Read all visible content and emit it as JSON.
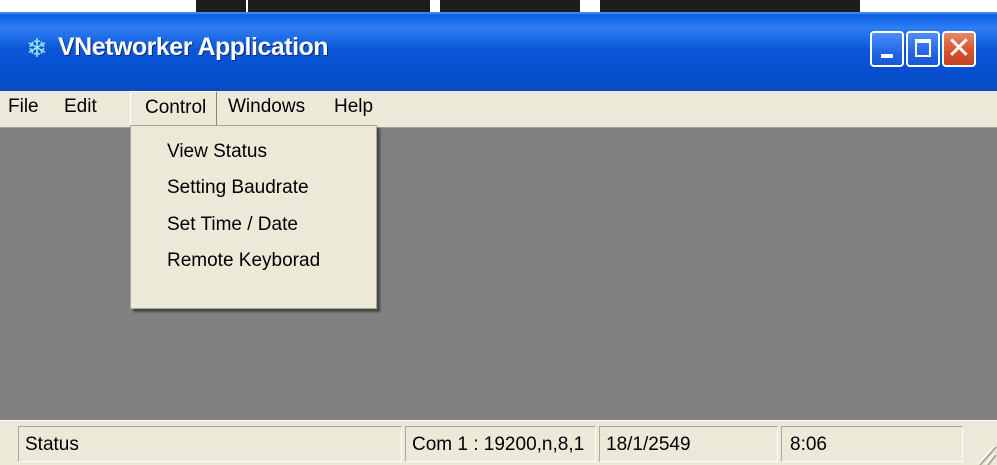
{
  "window": {
    "title": "VNetworker Application",
    "app_icon": "snowflake-icon",
    "controls": {
      "minimize_icon": "minimize-icon",
      "maximize_icon": "maximize-icon",
      "close_icon": "close-icon",
      "close_glyph": "✕"
    }
  },
  "menu": {
    "file": "File",
    "edit": "Edit",
    "control": "Control",
    "windows": "Windows",
    "help": "Help"
  },
  "control_menu": {
    "items": [
      "View Status",
      "Setting Baudrate",
      "Set Time / Date",
      "Remote Keyborad"
    ]
  },
  "statusbar": {
    "status": "Status",
    "com": "Com 1 : 19200,n,8,1",
    "date": "18/1/2549",
    "time": "8:06"
  },
  "colors": {
    "titlebar": "#0b58d8",
    "client_area": "#808080",
    "chrome": "#ece9d8",
    "close_button": "#d8532c"
  }
}
